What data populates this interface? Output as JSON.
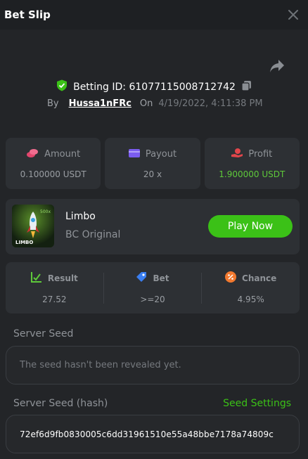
{
  "header": {
    "title": "Bet Slip",
    "close_icon": "close-icon"
  },
  "share_icon": "share-icon",
  "bet": {
    "id_label": "Betting ID: 61077115008712742",
    "by_label": "By",
    "user": "Hussa1nFRc",
    "on_label": "On",
    "date": "4/19/2022, 4:11:38 PM",
    "verified_icon": "shield-check-icon",
    "copy_icon": "copy-icon"
  },
  "stats": [
    {
      "label": "Amount",
      "value": "0.100000 USDT",
      "icon": "coins-icon",
      "icon_color": "#e2466d"
    },
    {
      "label": "Payout",
      "value": "20 x",
      "icon": "wallet-icon",
      "icon_color": "#7b5cf0"
    },
    {
      "label": "Profit",
      "value": "1.900000 USDT",
      "icon": "hand-coin-icon",
      "icon_color": "#e2464b",
      "value_color": "#5ec93a"
    }
  ],
  "game": {
    "name": "Limbo",
    "subtitle": "BC Original",
    "play_label": "Play Now",
    "thumb_text": "LIMBO",
    "thumb_badge": "500x"
  },
  "result": [
    {
      "label": "Result",
      "value": "27.52",
      "icon": "chart-check-icon",
      "icon_color": "#5ec93a"
    },
    {
      "label": "Bet",
      "value": ">=20",
      "icon": "bet-tag-icon",
      "icon_color": "#3a7ef0"
    },
    {
      "label": "Chance",
      "value": "4.95%",
      "icon": "percent-icon",
      "icon_color": "#f2792f"
    }
  ],
  "seed": {
    "server_seed_label": "Server Seed",
    "server_seed_value": "The seed hasn't been revealed yet.",
    "hash_label": "Server Seed (hash)",
    "settings_label": "Seed Settings",
    "hash_value": "72ef6d9fb0830005c6dd31961510e55a48bbe7178a74809c"
  },
  "colors": {
    "accent_green": "#3bc117",
    "panel": "#2d3034",
    "background": "#232528"
  }
}
